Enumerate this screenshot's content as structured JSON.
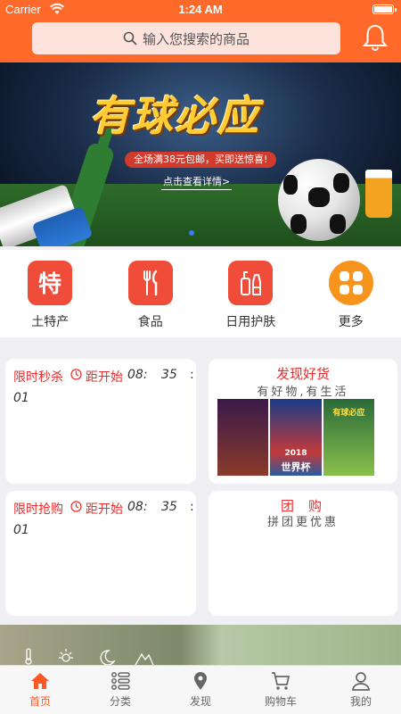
{
  "status": {
    "carrier": "Carrier",
    "time": "1:24 AM"
  },
  "header": {
    "search_placeholder": "输入您搜索的商品"
  },
  "banner": {
    "title": "有球必应",
    "promo": "全场满38元包邮，买即送惊喜!",
    "detail": "点击查看详情>"
  },
  "categories": [
    {
      "label": "土特产",
      "icon": "te-icon"
    },
    {
      "label": "食品",
      "icon": "utensils-icon"
    },
    {
      "label": "日用护肤",
      "icon": "skincare-icon"
    },
    {
      "label": "更多",
      "icon": "grid-icon"
    }
  ],
  "flash_sale": {
    "title": "限时秒杀",
    "distance": "距开始",
    "hours": "08:",
    "minutes": "35",
    "colon": ":",
    "seconds": "01"
  },
  "limited_buy": {
    "title": "限时抢购",
    "distance": "距开始",
    "hours": "08:",
    "minutes": "35",
    "colon": ":",
    "seconds": "01"
  },
  "discover": {
    "title": "发现好货",
    "subtitle": "有好物,有生活",
    "tags": [
      "有球必应",
      "世界杯",
      "2018"
    ]
  },
  "group": {
    "title": "团购",
    "subtitle": "拼团更优惠"
  },
  "tabs": [
    {
      "label": "首页",
      "icon": "home-icon",
      "active": true
    },
    {
      "label": "分类",
      "icon": "list-icon",
      "active": false
    },
    {
      "label": "发现",
      "icon": "location-icon",
      "active": false
    },
    {
      "label": "购物车",
      "icon": "cart-icon",
      "active": false
    },
    {
      "label": "我的",
      "icon": "user-icon",
      "active": false
    }
  ],
  "colors": {
    "accent": "#ff6a2b",
    "sale_red": "#e62e2e",
    "tab_active": "#ff5722"
  }
}
